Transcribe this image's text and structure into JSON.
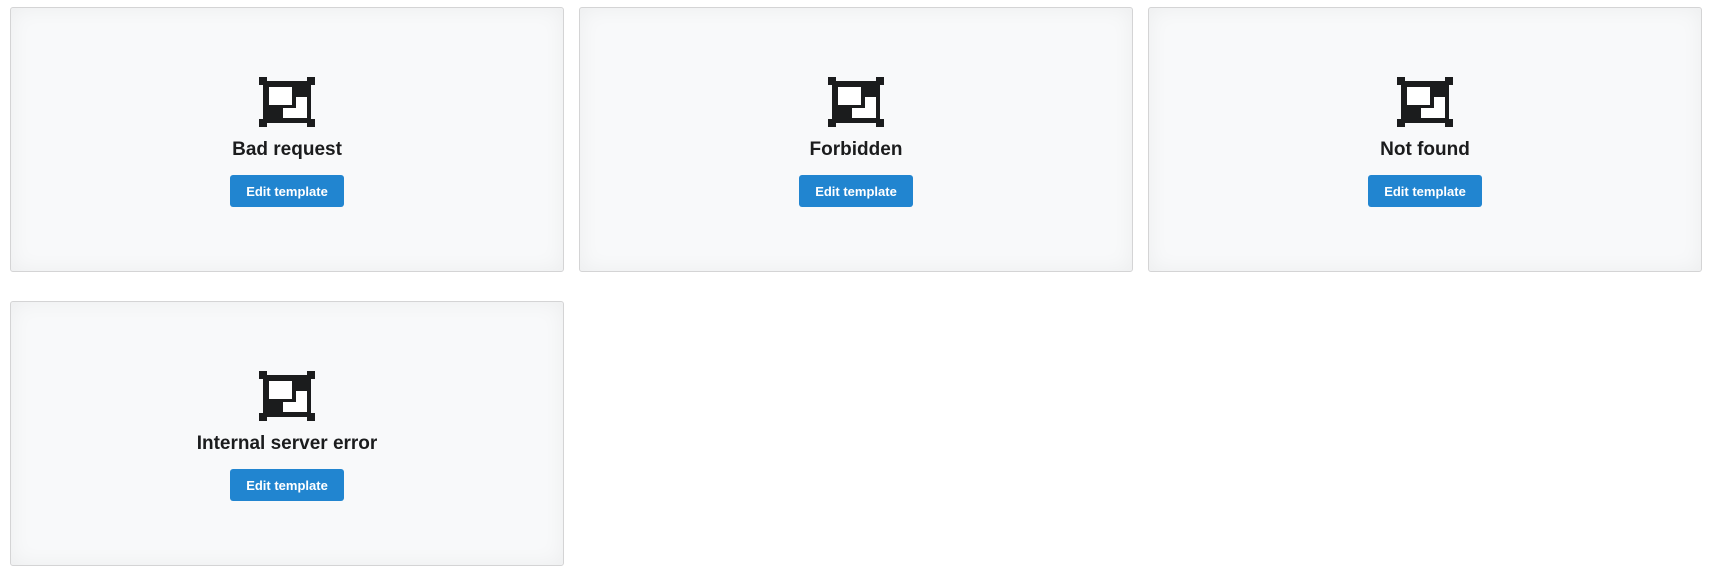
{
  "cards": [
    {
      "title": "Bad request",
      "button_label": "Edit template",
      "icon": "template-layout-icon"
    },
    {
      "title": "Forbidden",
      "button_label": "Edit template",
      "icon": "template-layout-icon"
    },
    {
      "title": "Not found",
      "button_label": "Edit template",
      "icon": "template-layout-icon"
    },
    {
      "title": "Internal server error",
      "button_label": "Edit template",
      "icon": "template-layout-icon"
    }
  ],
  "colors": {
    "button": "#2185d0",
    "card_background": "#f8f9fa",
    "card_border": "#d4d4d5",
    "icon": "#1b1c1d"
  }
}
